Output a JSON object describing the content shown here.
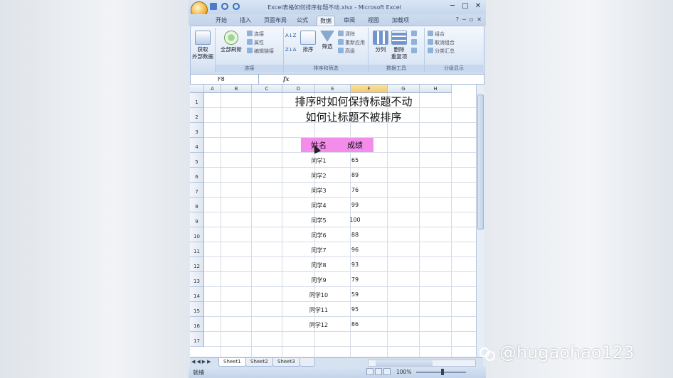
{
  "window": {
    "title": "Excel表格如何排序标题不动.xlsx - Microsoft Excel",
    "controls": [
      "─",
      "□",
      "✕"
    ]
  },
  "ribbon_tabs": [
    "开始",
    "插入",
    "页面布局",
    "公式",
    "数据",
    "审阅",
    "视图",
    "加载项"
  ],
  "active_tab": "数据",
  "ribbon": {
    "get_external": "获取\n外部数据",
    "refresh_all": "全部刷新",
    "connections": [
      "连接",
      "属性",
      "编辑链接"
    ],
    "connections_label": "连接",
    "sort_asc": "A↓Z",
    "sort_desc": "Z↓A",
    "sort": "排序",
    "filter": "筛选",
    "filter_small": [
      "清除",
      "重新应用",
      "高级"
    ],
    "sort_filter_label": "排序和筛选",
    "text_to_columns": "分列",
    "remove_dupes": "删除\n重复项",
    "data_tools_label": "数据工具",
    "outline": [
      "组合",
      "取消组合",
      "分类汇总"
    ],
    "outline_label": "分级显示"
  },
  "formula_bar": {
    "name_box": "F8",
    "fx": "fx",
    "value": ""
  },
  "columns": [
    "A",
    "B",
    "C",
    "D",
    "E",
    "F",
    "G",
    "H"
  ],
  "rows": [
    "1",
    "2",
    "3",
    "4",
    "5",
    "6",
    "7",
    "8",
    "9",
    "10",
    "11",
    "12",
    "13",
    "14",
    "15",
    "16",
    "17"
  ],
  "title_line1": "排序时如何保持标题不动",
  "title_line2": "如何让标题不被排序",
  "table": {
    "header_name": "姓名",
    "header_score": "成绩",
    "header_color": "#f48cec",
    "rows": [
      {
        "name": "同学1",
        "score": "65"
      },
      {
        "name": "同学2",
        "score": "89"
      },
      {
        "name": "同学3",
        "score": "76"
      },
      {
        "name": "同学4",
        "score": "99"
      },
      {
        "name": "同学5",
        "score": "100"
      },
      {
        "name": "同学6",
        "score": "88"
      },
      {
        "name": "同学7",
        "score": "96"
      },
      {
        "name": "同学8",
        "score": "93"
      },
      {
        "name": "同学9",
        "score": "79"
      },
      {
        "name": "同学10",
        "score": "59"
      },
      {
        "name": "同学11",
        "score": "95"
      },
      {
        "name": "同学12",
        "score": "86"
      }
    ]
  },
  "sheet_tabs": [
    "Sheet1",
    "Sheet2",
    "Sheet3"
  ],
  "active_sheet": "Sheet1",
  "status": {
    "ready": "就绪",
    "zoom": "100%"
  },
  "watermark": "@hugaohao123"
}
